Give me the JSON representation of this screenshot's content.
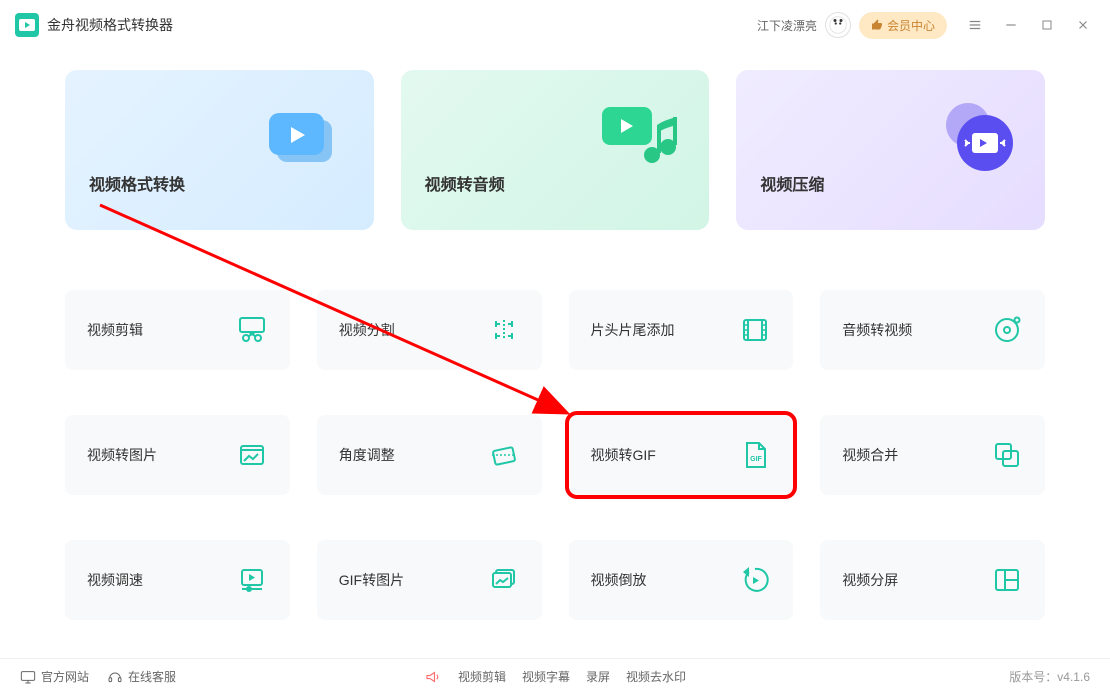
{
  "app": {
    "title": "金舟视频格式转换器"
  },
  "header": {
    "username": "江下凌漂亮",
    "member_label": "会员中心"
  },
  "features": [
    {
      "label": "视频格式转换"
    },
    {
      "label": "视频转音频"
    },
    {
      "label": "视频压缩"
    }
  ],
  "grid": [
    [
      {
        "label": "视频剪辑"
      },
      {
        "label": "视频分割"
      },
      {
        "label": "片头片尾添加"
      },
      {
        "label": "音频转视频"
      }
    ],
    [
      {
        "label": "视频转图片"
      },
      {
        "label": "角度调整"
      },
      {
        "label": "视频转GIF"
      },
      {
        "label": "视频合并"
      }
    ],
    [
      {
        "label": "视频调速"
      },
      {
        "label": "GIF转图片"
      },
      {
        "label": "视频倒放"
      },
      {
        "label": "视频分屏"
      }
    ]
  ],
  "footer": {
    "website": "官方网站",
    "support": "在线客服",
    "center_links": [
      "视频剪辑",
      "视频字幕",
      "录屏",
      "视频去水印"
    ],
    "version_label": "版本号：",
    "version": "v4.1.6"
  }
}
